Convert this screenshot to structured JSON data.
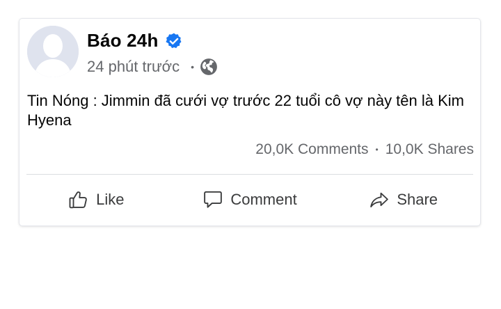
{
  "post": {
    "author_name": "Báo 24h",
    "timestamp": "24 phút trước",
    "meta_separator": "•",
    "audience_icon": "globe-icon",
    "verified_icon": "verified-badge-icon",
    "verified_color": "#1877f2",
    "text": "Tin Nóng : Jimmin đã cưới vợ trước 22 tuổi cô vợ này tên là Kim Hyena",
    "comments_count": "20,0K Comments",
    "stats_separator": "•",
    "shares_count": "10,0K Shares"
  },
  "actions": {
    "like_label": "Like",
    "comment_label": "Comment",
    "share_label": "Share"
  },
  "colors": {
    "primary_text": "#050505",
    "secondary_text": "#65676b",
    "action_text": "#3a3b3c",
    "divider": "#dadde1",
    "avatar_bg": "#dfe3ee"
  }
}
